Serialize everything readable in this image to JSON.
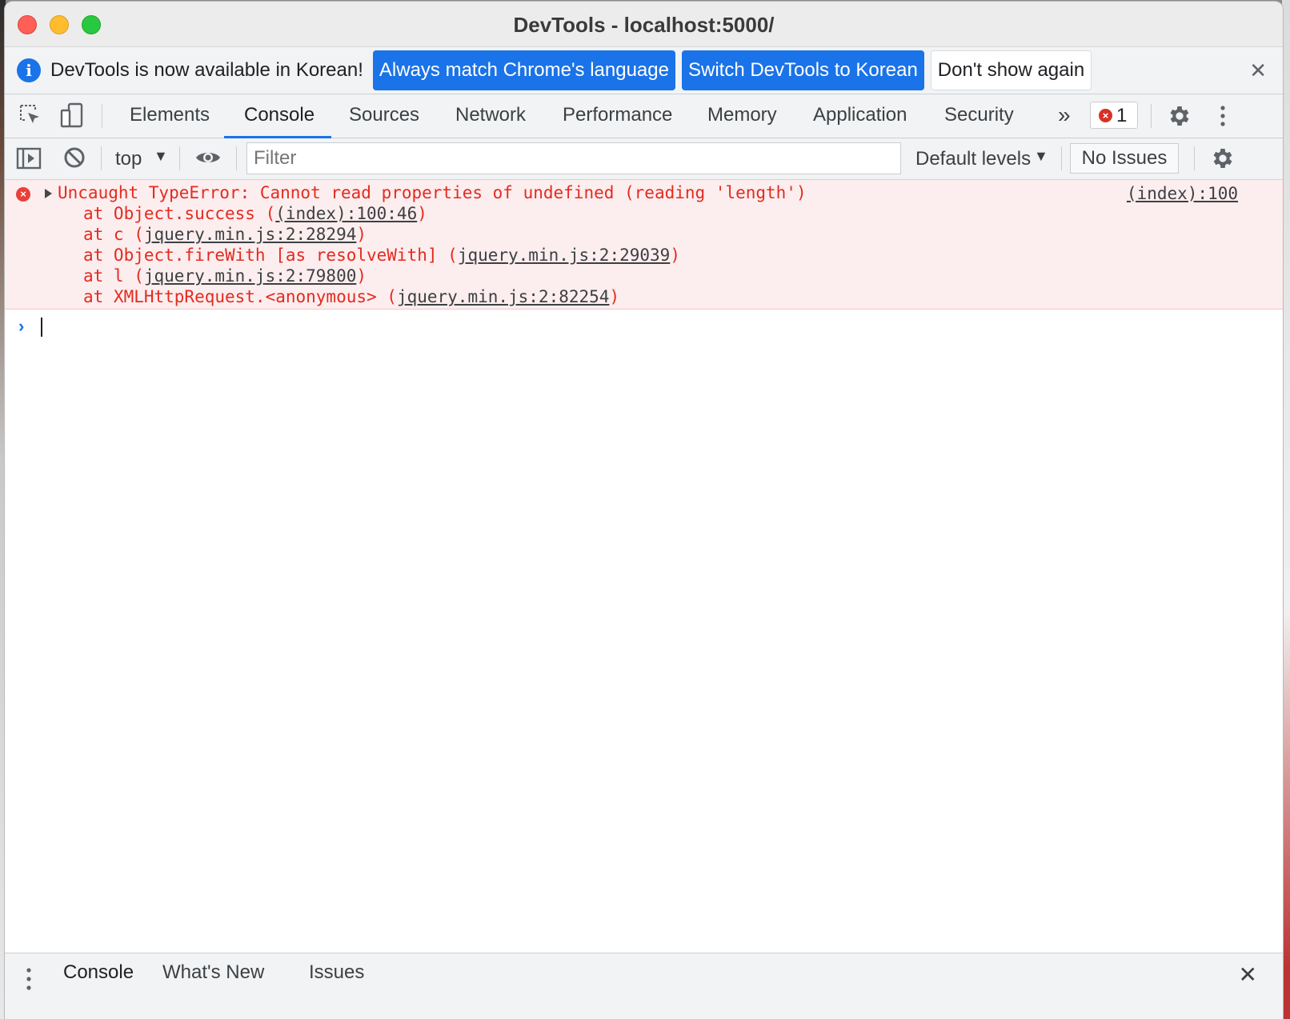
{
  "window": {
    "title": "DevTools - localhost:5000/"
  },
  "infobar": {
    "message": "DevTools is now available in Korean!",
    "buttons": {
      "match_language": "Always match Chrome's language",
      "switch_korean": "Switch DevTools to Korean",
      "dont_show": "Don't show again"
    },
    "close_glyph": "✕"
  },
  "tabs": {
    "items": [
      "Elements",
      "Console",
      "Sources",
      "Network",
      "Performance",
      "Memory",
      "Application",
      "Security"
    ],
    "active": "Console",
    "more_glyph": "»",
    "error_count": "1"
  },
  "console_toolbar": {
    "context": "top",
    "filter_placeholder": "Filter",
    "levels": "Default levels",
    "issues": "No Issues"
  },
  "messages": {
    "error": {
      "text": "Uncaught TypeError: Cannot read properties of undefined (reading 'length')",
      "source": "(index):100",
      "stack": [
        {
          "prefix": "at Object.success (",
          "link": "(index):100:46",
          "suffix": ")"
        },
        {
          "prefix": "at c (",
          "link": "jquery.min.js:2:28294",
          "suffix": ")"
        },
        {
          "prefix": "at Object.fireWith [as resolveWith] (",
          "link": "jquery.min.js:2:29039",
          "suffix": ")"
        },
        {
          "prefix": "at l (",
          "link": "jquery.min.js:2:79800",
          "suffix": ")"
        },
        {
          "prefix": "at XMLHttpRequest.<anonymous> (",
          "link": "jquery.min.js:2:82254",
          "suffix": ")"
        }
      ]
    }
  },
  "drawer": {
    "tabs": [
      "Console",
      "What's New",
      "Issues"
    ],
    "close_glyph": "✕"
  },
  "colors": {
    "accent": "#1a73e8",
    "error": "#e32b1f",
    "error_bg": "#fcedee"
  },
  "icons": [
    "inspect-element-icon",
    "device-toolbar-icon",
    "more-tabs-icon",
    "error-icon",
    "settings-gear-icon",
    "kebab-menu-icon",
    "sidebar-toggle-icon",
    "clear-console-icon",
    "eye-icon",
    "info-icon",
    "close-icon",
    "expand-arrow-icon",
    "prompt-arrow-icon"
  ]
}
